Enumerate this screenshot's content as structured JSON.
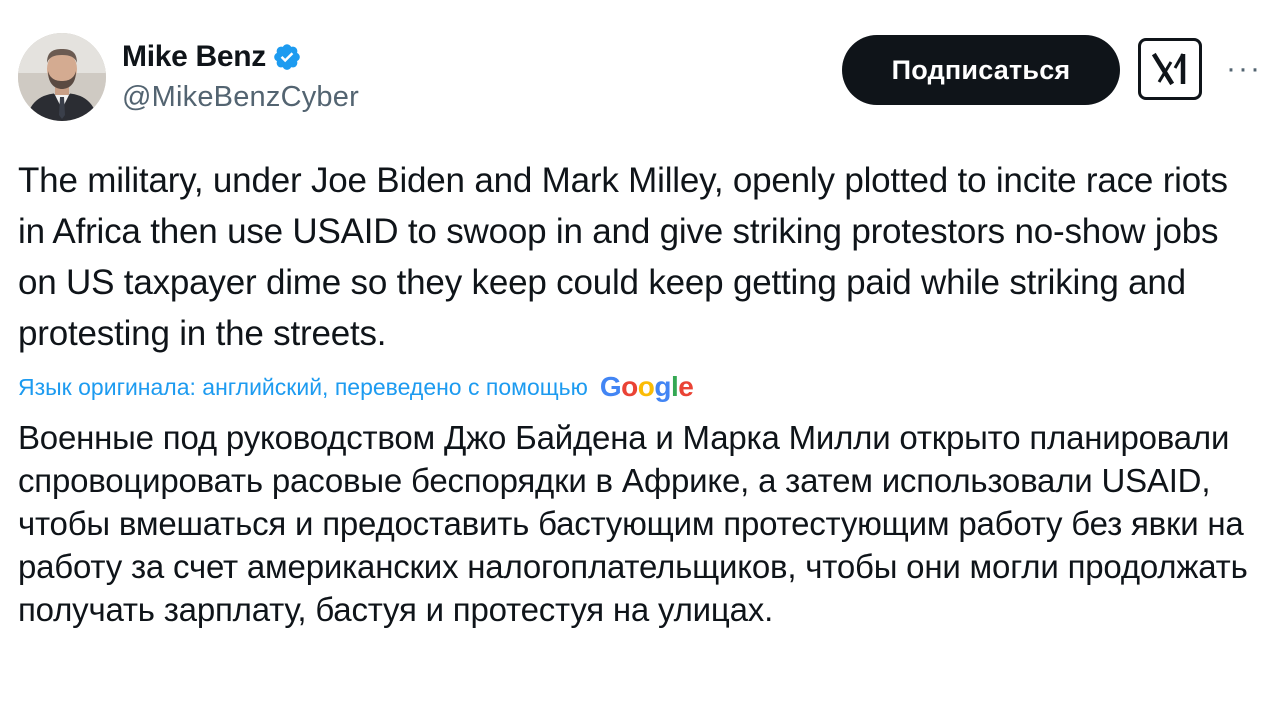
{
  "author": {
    "name": "Mike Benz",
    "handle": "@MikeBenzCyber",
    "verified": true,
    "avatar_icon": "avatar-photo"
  },
  "actions": {
    "follow_label": "Подписаться",
    "grok_icon": "grok-icon",
    "more_label": "···"
  },
  "tweet": {
    "text_original": "The military, under Joe Biden and Mark Milley, openly plotted to incite race riots in Africa then use USAID to swoop in and give striking protestors no-show jobs on US taxpayer dime so they keep could keep getting paid while striking and protesting in the streets.",
    "translation_note": "Язык оригинала: английский, переведено с помощью",
    "translation_provider": "Google",
    "text_translated": "Военные под руководством Джо Байдена и Марка Милли открыто планировали спровоцировать расовые беспорядки в Африке, а затем использовали USAID, чтобы вмешаться и предоставить бастующим протестующим работу без явки на работу за счет американских налогоплательщиков, чтобы они могли продолжать получать зарплату, бастуя и протестуя на улицах."
  },
  "colors": {
    "link_blue": "#1d9bf0",
    "text_primary": "#0f1419",
    "text_secondary": "#536471",
    "verified_blue": "#1d9bf0"
  }
}
